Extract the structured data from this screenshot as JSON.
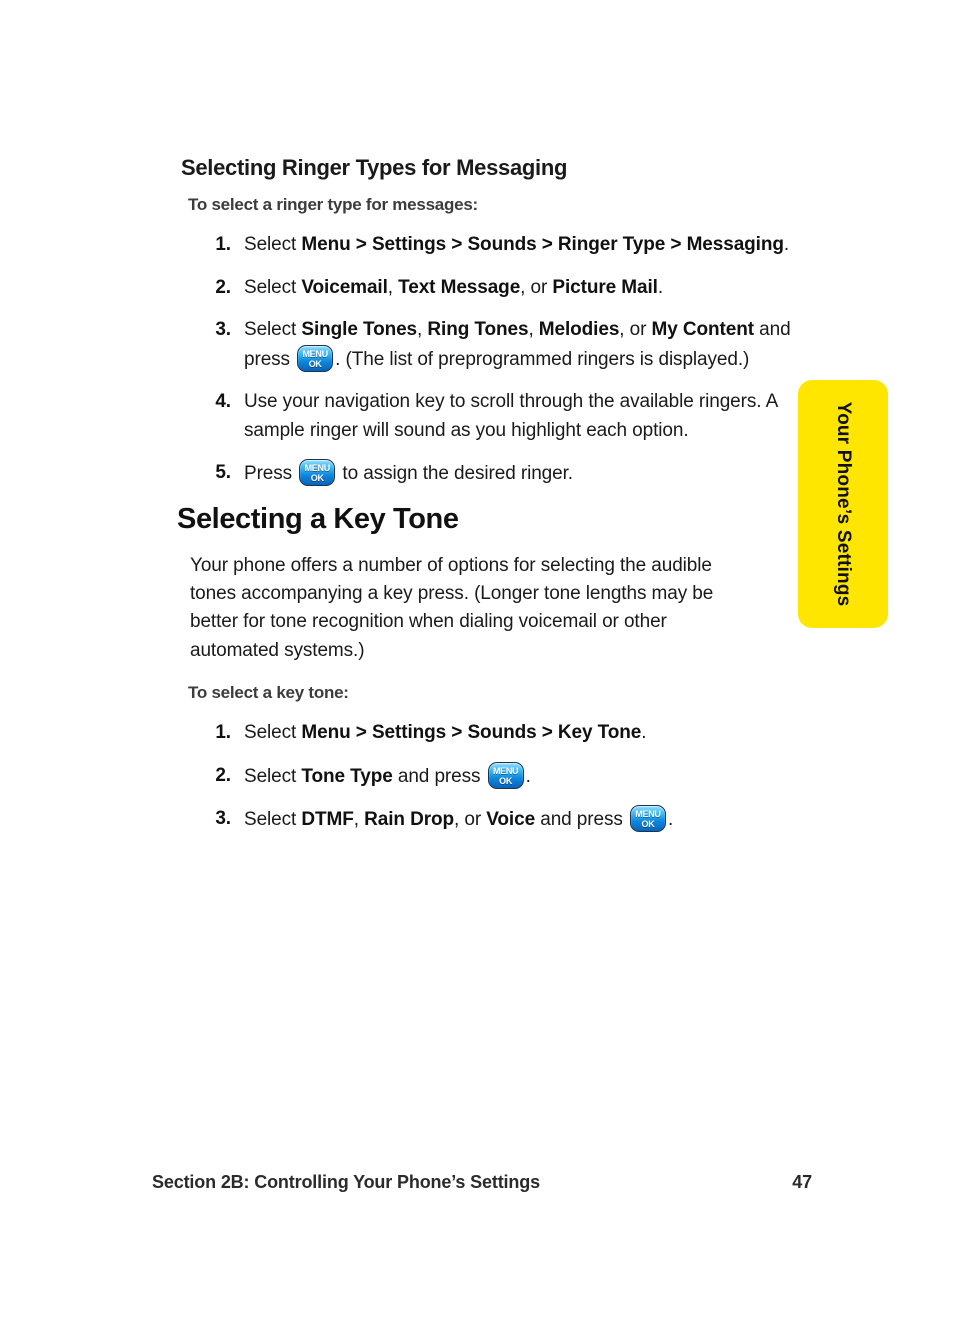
{
  "page": {
    "background_color": "#ffffff",
    "text_color": "#1a1a1a"
  },
  "side_tab": {
    "label": "Your Phone’s Settings",
    "color": "#ffe600",
    "text_color": "#111111"
  },
  "sections": [
    {
      "heading": "Selecting Ringer Types for Messaging",
      "heading_level": "sub",
      "leadin": "To select a ringer type for messages:",
      "steps": [
        {
          "number": "1.",
          "parts": [
            {
              "t": "Select ",
              "b": false
            },
            {
              "t": "Menu",
              "b": true
            },
            {
              "t": " > ",
              "b": true
            },
            {
              "t": "Settings",
              "b": true
            },
            {
              "t": " > ",
              "b": true
            },
            {
              "t": "Sounds",
              "b": true
            },
            {
              "t": " > ",
              "b": true
            },
            {
              "t": "Ringer Type",
              "b": true
            },
            {
              "t": " > ",
              "b": true
            },
            {
              "t": "Messaging",
              "b": true
            },
            {
              "t": ".",
              "b": false
            }
          ]
        },
        {
          "number": "2.",
          "parts": [
            {
              "t": "Select ",
              "b": false
            },
            {
              "t": "Voicemail",
              "b": true
            },
            {
              "t": ", ",
              "b": false
            },
            {
              "t": "Text Message",
              "b": true
            },
            {
              "t": ", or ",
              "b": false
            },
            {
              "t": "Picture Mail",
              "b": true
            },
            {
              "t": ".",
              "b": false
            }
          ]
        },
        {
          "number": "3.",
          "parts": [
            {
              "t": "Select ",
              "b": false
            },
            {
              "t": "Single Tones",
              "b": true
            },
            {
              "t": ", ",
              "b": false
            },
            {
              "t": "Ring Tones",
              "b": true
            },
            {
              "t": ", ",
              "b": false
            },
            {
              "t": "Melodies",
              "b": true
            },
            {
              "t": ", or ",
              "b": false
            },
            {
              "t": "My Content",
              "b": true
            },
            {
              "t": " and press ",
              "b": false
            },
            {
              "key": "menu-ok"
            },
            {
              "t": ". (The list of preprogrammed ringers is displayed.)",
              "b": false
            }
          ]
        },
        {
          "number": "4.",
          "parts": [
            {
              "t": "Use your navigation key to scroll through the available ringers. A sample ringer will sound as you highlight each option.",
              "b": false
            }
          ]
        },
        {
          "number": "5.",
          "parts": [
            {
              "t": "Press ",
              "b": false
            },
            {
              "key": "menu-ok"
            },
            {
              "t": " to assign the desired ringer.",
              "b": false
            }
          ]
        }
      ]
    },
    {
      "heading": "Selecting a Key Tone",
      "heading_level": "main",
      "paragraph": "Your phone offers a number of options for selecting the audible tones accompanying a key press. (Longer tone lengths may be better for tone recognition when dialing voicemail or other automated systems.)",
      "leadin": "To select a key tone:",
      "steps": [
        {
          "number": "1.",
          "parts": [
            {
              "t": "Select ",
              "b": false
            },
            {
              "t": "Menu",
              "b": true
            },
            {
              "t": " > ",
              "b": true
            },
            {
              "t": "Settings",
              "b": true
            },
            {
              "t": " > ",
              "b": true
            },
            {
              "t": "Sounds",
              "b": true
            },
            {
              "t": " > ",
              "b": true
            },
            {
              "t": "Key Tone",
              "b": true
            },
            {
              "t": ".",
              "b": false
            }
          ]
        },
        {
          "number": "2.",
          "parts": [
            {
              "t": "Select ",
              "b": false
            },
            {
              "t": "Tone Type",
              "b": true
            },
            {
              "t": " and press ",
              "b": false
            },
            {
              "key": "menu-ok"
            },
            {
              "t": ".",
              "b": false
            }
          ]
        },
        {
          "number": "3.",
          "parts": [
            {
              "t": "Select ",
              "b": false
            },
            {
              "t": "DTMF",
              "b": true
            },
            {
              "t": ", ",
              "b": false
            },
            {
              "t": "Rain Drop",
              "b": true
            },
            {
              "t": ", or ",
              "b": false
            },
            {
              "t": "Voice",
              "b": true
            },
            {
              "t": " and press ",
              "b": false
            },
            {
              "key": "menu-ok"
            },
            {
              "t": ".",
              "b": false
            }
          ]
        }
      ]
    }
  ],
  "icons": {
    "menu_ok_key": {
      "name": "menu-ok-key-icon",
      "line1": "MENU",
      "line2": "OK",
      "color": "#0c86dd",
      "text_color": "#ffffff"
    }
  },
  "footer": {
    "section_label": "Section 2B: Controlling Your Phone’s Settings",
    "page_number": "47"
  }
}
